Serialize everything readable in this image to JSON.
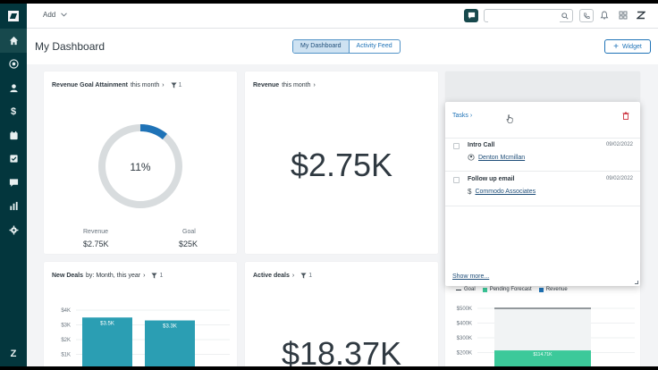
{
  "topbar": {
    "add_label": "Add",
    "search_placeholder": ""
  },
  "sidebar": {
    "items": [
      {
        "icon": "home-icon"
      },
      {
        "icon": "deals-icon"
      },
      {
        "icon": "user-icon"
      },
      {
        "icon": "dollar-icon"
      },
      {
        "icon": "calendar-icon"
      },
      {
        "icon": "tasks-icon"
      },
      {
        "icon": "chat-icon"
      },
      {
        "icon": "reports-icon"
      },
      {
        "icon": "settings-icon"
      }
    ],
    "bottom_logo": "Z"
  },
  "header": {
    "title": "My Dashboard",
    "tabs": [
      "My Dashboard",
      "Activity Feed"
    ],
    "widget_label": "Widget"
  },
  "cards": {
    "revenue_goal": {
      "title_bold": "Revenue Goal Attainment",
      "title_rest": "this month",
      "filter_count": "1",
      "percent_label": "11%",
      "percent_value": 0.11,
      "revenue_label": "Revenue",
      "revenue_value": "$2.75K",
      "goal_label": "Goal",
      "goal_value": "$25K"
    },
    "revenue": {
      "title_bold": "Revenue",
      "title_rest": "this month",
      "value": "$2.75K"
    },
    "new_deals": {
      "title_bold": "New Deals",
      "title_rest": "by: Month, this year",
      "filter_count": "1"
    },
    "active_deals": {
      "title_bold": "Active deals",
      "filter_count": "1",
      "value": "$18.37K"
    },
    "forecast": {
      "legend": [
        "Goal",
        "Pending Forecast",
        "Revenue"
      ],
      "bar_label": "$114.71K"
    }
  },
  "tasks": {
    "title": "Tasks",
    "items": [
      {
        "name": "Intro Call",
        "date": "09/02/2022",
        "related": "Denton Mcmillan",
        "related_icon": "deal-icon"
      },
      {
        "name": "Follow up email",
        "date": "09/02/2022",
        "related": "Commodo Associates",
        "related_icon": "dollar-icon"
      }
    ],
    "show_more": "Show more..."
  },
  "colors": {
    "sidebar": "#03363d",
    "accent_blue": "#1f73b7",
    "donut": "#1f73b7",
    "bar_teal": "#2b9eb3",
    "pending_green": "#3cc99a"
  },
  "chart_data": [
    {
      "type": "bar",
      "categories": [
        "",
        ""
      ],
      "values": [
        3.5,
        3.3
      ],
      "ylabel": "",
      "y_ticks": [
        "$4K",
        "$3K",
        "$2K",
        "$1K"
      ],
      "data_labels": [
        "$3.5K",
        "$3.3K"
      ],
      "ylim": [
        0,
        4
      ]
    },
    {
      "type": "bar",
      "series": [
        {
          "name": "Goal",
          "values": [
            500
          ]
        },
        {
          "name": "Pending Forecast",
          "values": [
            114.71
          ]
        },
        {
          "name": "Revenue",
          "values": [
            0
          ]
        }
      ],
      "y_ticks": [
        "$500K",
        "$400K",
        "$300K",
        "$200K"
      ],
      "data_labels": [
        "$114.71K"
      ],
      "ylim": [
        100,
        500
      ]
    }
  ]
}
